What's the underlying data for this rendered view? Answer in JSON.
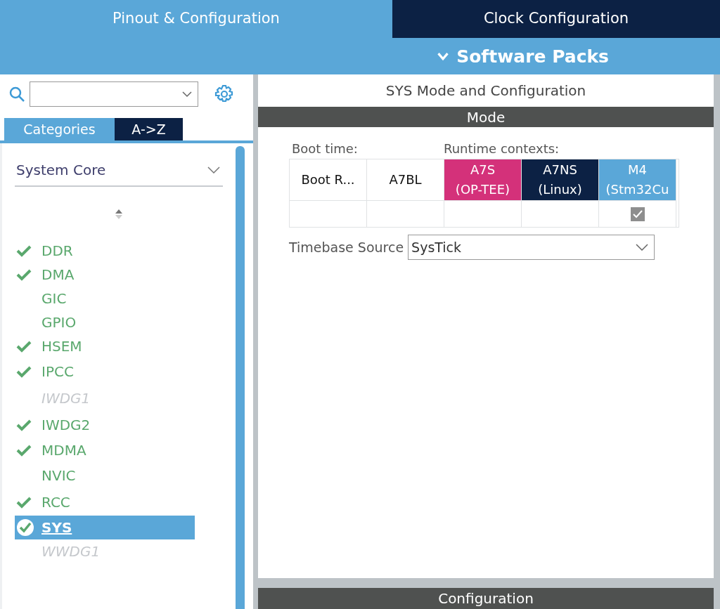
{
  "top_tabs": [
    {
      "label": "Pinout & Configuration",
      "selected": true
    },
    {
      "label": "Clock Configuration",
      "selected": false
    }
  ],
  "software_packs": {
    "label": "Software Packs"
  },
  "sidebar": {
    "view_tabs": [
      {
        "label": "Categories",
        "selected": true
      },
      {
        "label": "A->Z",
        "selected": false
      }
    ],
    "category": "System Core",
    "items": [
      {
        "label": "DDR",
        "checked": true,
        "disabled": false,
        "selected": false
      },
      {
        "label": "DMA",
        "checked": true,
        "disabled": false,
        "selected": false
      },
      {
        "label": "GIC",
        "checked": false,
        "disabled": false,
        "selected": false
      },
      {
        "label": "GPIO",
        "checked": false,
        "disabled": false,
        "selected": false
      },
      {
        "label": "HSEM",
        "checked": true,
        "disabled": false,
        "selected": false
      },
      {
        "label": "IPCC",
        "checked": true,
        "disabled": false,
        "selected": false
      },
      {
        "label": "IWDG1",
        "checked": false,
        "disabled": true,
        "selected": false
      },
      {
        "label": "IWDG2",
        "checked": true,
        "disabled": false,
        "selected": false
      },
      {
        "label": "MDMA",
        "checked": true,
        "disabled": false,
        "selected": false
      },
      {
        "label": "NVIC",
        "checked": false,
        "disabled": false,
        "selected": false
      },
      {
        "label": "RCC",
        "checked": true,
        "disabled": false,
        "selected": false
      },
      {
        "label": "SYS",
        "checked": true,
        "disabled": false,
        "selected": true
      },
      {
        "label": "WWDG1",
        "checked": false,
        "disabled": true,
        "selected": false
      }
    ]
  },
  "panel": {
    "title": "SYS Mode and Configuration",
    "mode_header": "Mode",
    "boot_label": "Boot time:",
    "runtime_label": "Runtime contexts:",
    "contexts": [
      {
        "line1": "Boot R...",
        "color": "#ffffff",
        "checked": false
      },
      {
        "line1": "A7BL",
        "color": "#ffffff",
        "checked": false
      },
      {
        "line1": "A7S",
        "line2": "(OP-TEE)",
        "color": "#d4317a",
        "checked": false
      },
      {
        "line1": "A7NS",
        "line2": "(Linux)",
        "color": "#0c2144",
        "checked": false
      },
      {
        "line1": "M4",
        "line2": "(Stm32Cu",
        "color": "#5aa7d8",
        "checked": true
      }
    ],
    "timebase": {
      "label": "Timebase Source",
      "value": "SysTick"
    },
    "config_header": "Configuration"
  }
}
